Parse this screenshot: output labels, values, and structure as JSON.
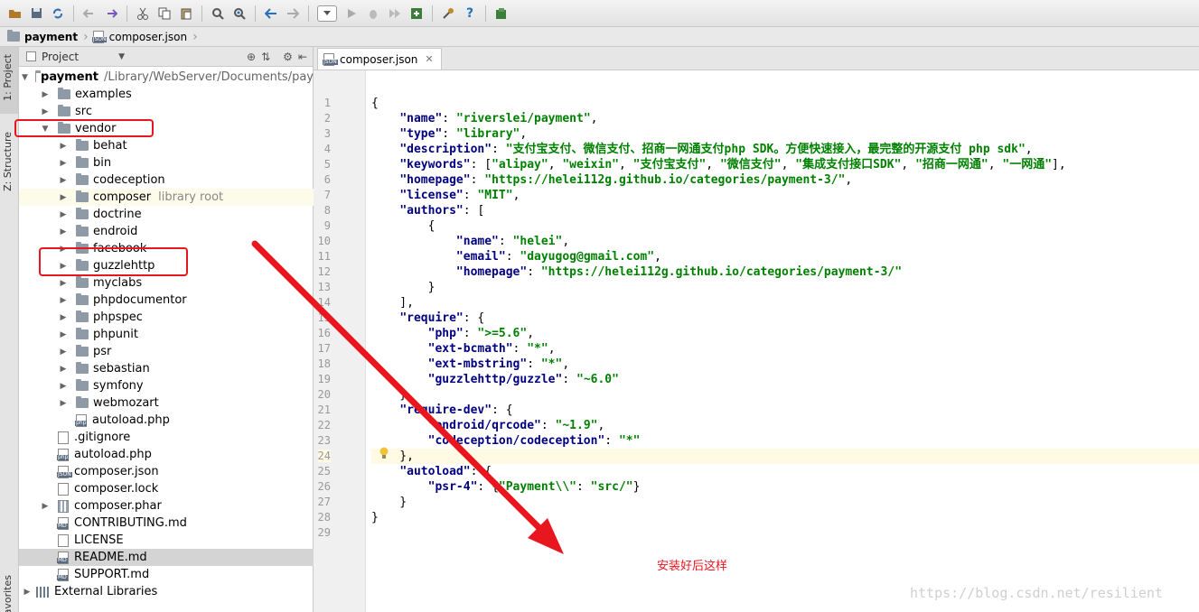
{
  "navbar": {
    "project": "payment",
    "file": "composer.json"
  },
  "side_tabs": {
    "project": "1: Project",
    "structure": "Z: Structure",
    "favorites": "avorites"
  },
  "project_panel": {
    "title": "Project",
    "root": {
      "name": "payment",
      "path": "/Library/WebServer/Documents/pay"
    },
    "rows": [
      {
        "label": "examples",
        "kind": "folder",
        "depth": 1,
        "arrow": "right"
      },
      {
        "label": "src",
        "kind": "folder",
        "depth": 1,
        "arrow": "right"
      },
      {
        "label": "vendor",
        "kind": "folder",
        "depth": 1,
        "arrow": "down"
      },
      {
        "label": "behat",
        "kind": "folder",
        "depth": 2,
        "arrow": "right"
      },
      {
        "label": "bin",
        "kind": "folder",
        "depth": 2,
        "arrow": "right"
      },
      {
        "label": "codeception",
        "kind": "folder",
        "depth": 2,
        "arrow": "right"
      },
      {
        "label": "composer",
        "kind": "folder",
        "depth": 2,
        "arrow": "right",
        "suffix": "library root"
      },
      {
        "label": "doctrine",
        "kind": "folder",
        "depth": 2,
        "arrow": "right"
      },
      {
        "label": "endroid",
        "kind": "folder",
        "depth": 2,
        "arrow": "right"
      },
      {
        "label": "facebook",
        "kind": "folder",
        "depth": 2,
        "arrow": "right"
      },
      {
        "label": "guzzlehttp",
        "kind": "folder",
        "depth": 2,
        "arrow": "right"
      },
      {
        "label": "myclabs",
        "kind": "folder",
        "depth": 2,
        "arrow": "right"
      },
      {
        "label": "phpdocumentor",
        "kind": "folder",
        "depth": 2,
        "arrow": "right"
      },
      {
        "label": "phpspec",
        "kind": "folder",
        "depth": 2,
        "arrow": "right"
      },
      {
        "label": "phpunit",
        "kind": "folder",
        "depth": 2,
        "arrow": "right"
      },
      {
        "label": "psr",
        "kind": "folder",
        "depth": 2,
        "arrow": "right"
      },
      {
        "label": "sebastian",
        "kind": "folder",
        "depth": 2,
        "arrow": "right"
      },
      {
        "label": "symfony",
        "kind": "folder",
        "depth": 2,
        "arrow": "right"
      },
      {
        "label": "webmozart",
        "kind": "folder",
        "depth": 2,
        "arrow": "right"
      },
      {
        "label": "autoload.php",
        "kind": "php",
        "depth": 2,
        "arrow": ""
      },
      {
        "label": ".gitignore",
        "kind": "text",
        "depth": 1,
        "arrow": ""
      },
      {
        "label": "autoload.php",
        "kind": "php",
        "depth": 1,
        "arrow": ""
      },
      {
        "label": "composer.json",
        "kind": "json",
        "depth": 1,
        "arrow": ""
      },
      {
        "label": "composer.lock",
        "kind": "text",
        "depth": 1,
        "arrow": ""
      },
      {
        "label": "composer.phar",
        "kind": "phar",
        "depth": 1,
        "arrow": "right"
      },
      {
        "label": "CONTRIBUTING.md",
        "kind": "md",
        "depth": 1,
        "arrow": ""
      },
      {
        "label": "LICENSE",
        "kind": "text",
        "depth": 1,
        "arrow": ""
      },
      {
        "label": "README.md",
        "kind": "md",
        "depth": 1,
        "arrow": "",
        "selected": true
      },
      {
        "label": "SUPPORT.md",
        "kind": "md",
        "depth": 1,
        "arrow": ""
      },
      {
        "label": "External Libraries",
        "kind": "lib",
        "depth": 0,
        "arrow": "right"
      }
    ]
  },
  "editor": {
    "tab": "composer.json",
    "current_line": 24,
    "lines": [
      [
        [
          "p",
          "{"
        ]
      ],
      [
        [
          "p",
          "    "
        ],
        [
          "k",
          "\"name\""
        ],
        [
          "p",
          ": "
        ],
        [
          "s",
          "\"riverslei/payment\""
        ],
        [
          "p",
          ","
        ]
      ],
      [
        [
          "p",
          "    "
        ],
        [
          "k",
          "\"type\""
        ],
        [
          "p",
          ": "
        ],
        [
          "s",
          "\"library\""
        ],
        [
          "p",
          ","
        ]
      ],
      [
        [
          "p",
          "    "
        ],
        [
          "k",
          "\"description\""
        ],
        [
          "p",
          ": "
        ],
        [
          "s",
          "\"支付宝支付、微信支付、招商一网通支付php SDK。方便快速接入，最完整的开源支付 php sdk\""
        ],
        [
          "p",
          ","
        ]
      ],
      [
        [
          "p",
          "    "
        ],
        [
          "k",
          "\"keywords\""
        ],
        [
          "p",
          ": ["
        ],
        [
          "s",
          "\"alipay\""
        ],
        [
          "p",
          ", "
        ],
        [
          "s",
          "\"weixin\""
        ],
        [
          "p",
          ", "
        ],
        [
          "s",
          "\"支付宝支付\""
        ],
        [
          "p",
          ", "
        ],
        [
          "s",
          "\"微信支付\""
        ],
        [
          "p",
          ", "
        ],
        [
          "s",
          "\"集成支付接口SDK\""
        ],
        [
          "p",
          ", "
        ],
        [
          "s",
          "\"招商一网通\""
        ],
        [
          "p",
          ", "
        ],
        [
          "s",
          "\"一网通\""
        ],
        [
          "p",
          "],"
        ]
      ],
      [
        [
          "p",
          "    "
        ],
        [
          "k",
          "\"homepage\""
        ],
        [
          "p",
          ": "
        ],
        [
          "s",
          "\"https://helei112g.github.io/categories/payment-3/\""
        ],
        [
          "p",
          ","
        ]
      ],
      [
        [
          "p",
          "    "
        ],
        [
          "k",
          "\"license\""
        ],
        [
          "p",
          ": "
        ],
        [
          "s",
          "\"MIT\""
        ],
        [
          "p",
          ","
        ]
      ],
      [
        [
          "p",
          "    "
        ],
        [
          "k",
          "\"authors\""
        ],
        [
          "p",
          ": ["
        ]
      ],
      [
        [
          "p",
          "        {"
        ]
      ],
      [
        [
          "p",
          "            "
        ],
        [
          "k",
          "\"name\""
        ],
        [
          "p",
          ": "
        ],
        [
          "s",
          "\"helei\""
        ],
        [
          "p",
          ","
        ]
      ],
      [
        [
          "p",
          "            "
        ],
        [
          "k",
          "\"email\""
        ],
        [
          "p",
          ": "
        ],
        [
          "s",
          "\"dayugog@gmail.com\""
        ],
        [
          "p",
          ","
        ]
      ],
      [
        [
          "p",
          "            "
        ],
        [
          "k",
          "\"homepage\""
        ],
        [
          "p",
          ": "
        ],
        [
          "s",
          "\"https://helei112g.github.io/categories/payment-3/\""
        ]
      ],
      [
        [
          "p",
          "        }"
        ]
      ],
      [
        [
          "p",
          "    ],"
        ]
      ],
      [
        [
          "p",
          "    "
        ],
        [
          "k",
          "\"require\""
        ],
        [
          "p",
          ": {"
        ]
      ],
      [
        [
          "p",
          "        "
        ],
        [
          "k",
          "\"php\""
        ],
        [
          "p",
          ": "
        ],
        [
          "s",
          "\">=5.6\""
        ],
        [
          "p",
          ","
        ]
      ],
      [
        [
          "p",
          "        "
        ],
        [
          "k",
          "\"ext-bcmath\""
        ],
        [
          "p",
          ": "
        ],
        [
          "s",
          "\"*\""
        ],
        [
          "p",
          ","
        ]
      ],
      [
        [
          "p",
          "        "
        ],
        [
          "k",
          "\"ext-mbstring\""
        ],
        [
          "p",
          ": "
        ],
        [
          "s",
          "\"*\""
        ],
        [
          "p",
          ","
        ]
      ],
      [
        [
          "p",
          "        "
        ],
        [
          "k",
          "\"guzzlehttp/guzzle\""
        ],
        [
          "p",
          ": "
        ],
        [
          "s",
          "\"~6.0\""
        ]
      ],
      [
        [
          "p",
          "    },"
        ]
      ],
      [
        [
          "p",
          "    "
        ],
        [
          "k",
          "\"require-dev\""
        ],
        [
          "p",
          ": {"
        ]
      ],
      [
        [
          "p",
          "        "
        ],
        [
          "k",
          "\"endroid/qrcode\""
        ],
        [
          "p",
          ": "
        ],
        [
          "s",
          "\"~1.9\""
        ],
        [
          "p",
          ","
        ]
      ],
      [
        [
          "p",
          "        "
        ],
        [
          "k",
          "\"codeception/codeception\""
        ],
        [
          "p",
          ": "
        ],
        [
          "s",
          "\"*\""
        ]
      ],
      [
        [
          "p",
          "    },"
        ]
      ],
      [
        [
          "p",
          "    "
        ],
        [
          "k",
          "\"autoload\""
        ],
        [
          "p",
          ": {"
        ]
      ],
      [
        [
          "p",
          "        "
        ],
        [
          "k",
          "\"psr-4\""
        ],
        [
          "p",
          ": {"
        ],
        [
          "s",
          "\"Payment\\\\\""
        ],
        [
          "p",
          ": "
        ],
        [
          "s",
          "\"src/\""
        ],
        [
          "p",
          "}"
        ]
      ],
      [
        [
          "p",
          "    }"
        ]
      ],
      [
        [
          "p",
          "}"
        ]
      ],
      [
        [
          "p",
          ""
        ]
      ]
    ]
  },
  "annotation": {
    "caption": "安装好后这样",
    "color": "#e8161e"
  },
  "watermark": "https://blog.csdn.net/resilient",
  "colors": {
    "keyword": "#000080",
    "string": "#008000",
    "selection": "#d4d4d4",
    "current_line": "#fffae3",
    "highlight_box": "#e8161e"
  }
}
